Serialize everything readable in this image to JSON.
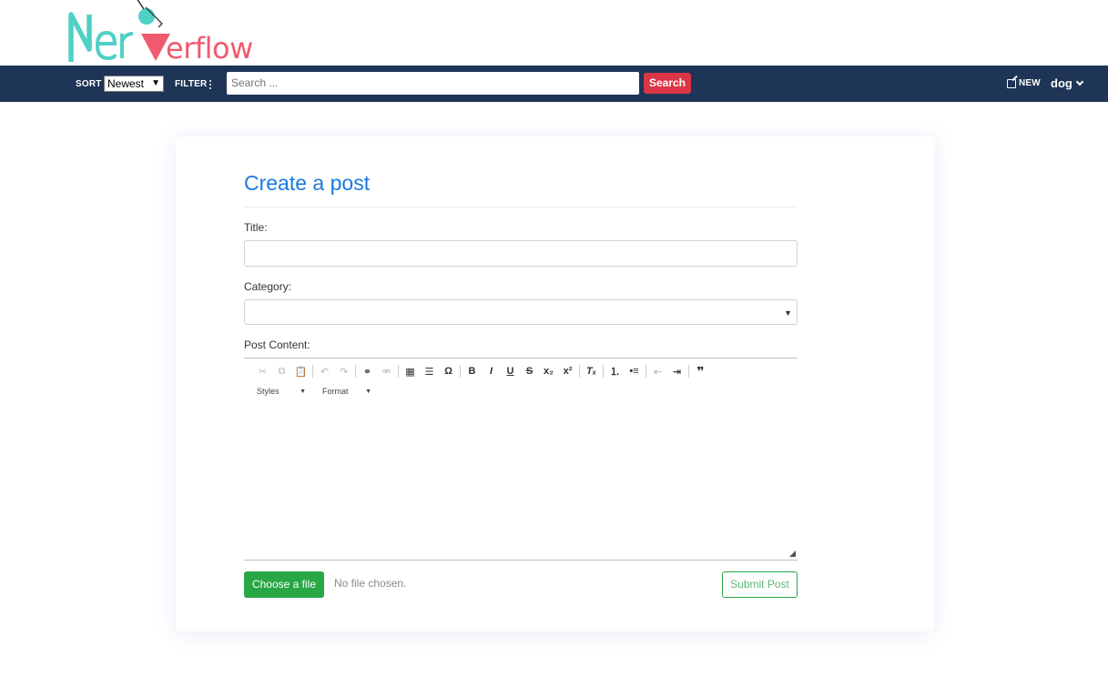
{
  "logo": {
    "text": "NerdOverflow"
  },
  "nav": {
    "sort_label": "SORT",
    "sort_value": "Newest",
    "filter_label": "FILTER",
    "search_placeholder": "Search ...",
    "search_button": "Search",
    "new_label": "NEW",
    "username": "dog"
  },
  "form": {
    "title": "Create a post",
    "title_label": "Title:",
    "title_value": "",
    "category_label": "Category:",
    "category_value": "",
    "content_label": "Post Content:",
    "styles_combo": "Styles",
    "format_combo": "Format",
    "choose_file": "Choose a file",
    "no_file": "No file chosen.",
    "submit": "Submit Post"
  },
  "toolbar_icons": [
    "cut-icon",
    "copy-icon",
    "paste-icon",
    "undo-icon",
    "redo-icon",
    "link-icon",
    "unlink-icon",
    "table-icon",
    "horizontal-line-icon",
    "special-char-icon",
    "bold-icon",
    "italic-icon",
    "underline-icon",
    "strike-icon",
    "subscript-icon",
    "superscript-icon",
    "remove-format-icon",
    "numbered-list-icon",
    "bulleted-list-icon",
    "outdent-icon",
    "indent-icon",
    "blockquote-icon"
  ],
  "colors": {
    "navbar": "#1e3557",
    "logo_teal": "#4fd1c5",
    "logo_coral": "#f05a6e",
    "title_blue": "#1a7ae0",
    "search_red": "#dc3545",
    "green": "#28a745"
  }
}
